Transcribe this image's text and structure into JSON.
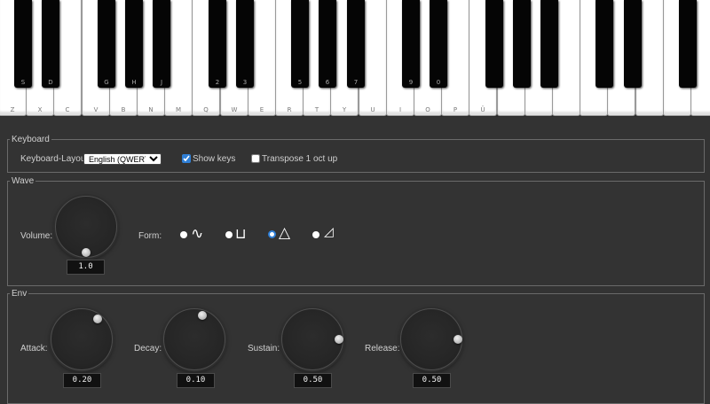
{
  "piano": {
    "white_keys": [
      "Z",
      "X",
      "C",
      "V",
      "B",
      "N",
      "M",
      "Q",
      "W",
      "E",
      "R",
      "T",
      "Y",
      "U",
      "I",
      "O",
      "P",
      "Ü",
      "",
      "",
      "",
      "",
      "",
      "",
      "",
      ""
    ],
    "black_keys": [
      {
        "after": 0,
        "label": "S"
      },
      {
        "after": 1,
        "label": "D"
      },
      {
        "after": 3,
        "label": "G"
      },
      {
        "after": 4,
        "label": "H"
      },
      {
        "after": 5,
        "label": "J"
      },
      {
        "after": 7,
        "label": "2"
      },
      {
        "after": 8,
        "label": "3"
      },
      {
        "after": 10,
        "label": "5"
      },
      {
        "after": 11,
        "label": "6"
      },
      {
        "after": 12,
        "label": "7"
      },
      {
        "after": 14,
        "label": "9"
      },
      {
        "after": 15,
        "label": "0"
      },
      {
        "after": 17,
        "label": ""
      },
      {
        "after": 18,
        "label": ""
      },
      {
        "after": 19,
        "label": ""
      },
      {
        "after": 21,
        "label": ""
      },
      {
        "after": 22,
        "label": ""
      },
      {
        "after": 24,
        "label": ""
      }
    ]
  },
  "keyboard": {
    "legend": "Keyboard",
    "layout_label": "Keyboard-Layout:",
    "layout_value": "English (QWERTY)",
    "show_keys_label": "Show keys",
    "show_keys_checked": true,
    "transpose_label": "Transpose 1 oct up",
    "transpose_checked": false
  },
  "wave": {
    "legend": "Wave",
    "volume_label": "Volume:",
    "volume_value": "1.0",
    "form_label": "Form:",
    "forms": [
      {
        "icon": "sine-wave-icon",
        "glyph": "∿",
        "selected": false
      },
      {
        "icon": "square-wave-icon",
        "glyph": "⊔",
        "selected": false
      },
      {
        "icon": "triangle-wave-icon",
        "glyph": "△",
        "selected": true
      },
      {
        "icon": "sawtooth-wave-icon",
        "glyph": "◿",
        "selected": false
      }
    ]
  },
  "env": {
    "legend": "Env",
    "attack_label": "Attack:",
    "attack_value": "0.20",
    "decay_label": "Decay:",
    "decay_value": "0.10",
    "sustain_label": "Sustain:",
    "sustain_value": "0.50",
    "release_label": "Release:",
    "release_value": "0.50"
  },
  "colors": {
    "background": "#333333",
    "accent": "#2f7fd6"
  }
}
